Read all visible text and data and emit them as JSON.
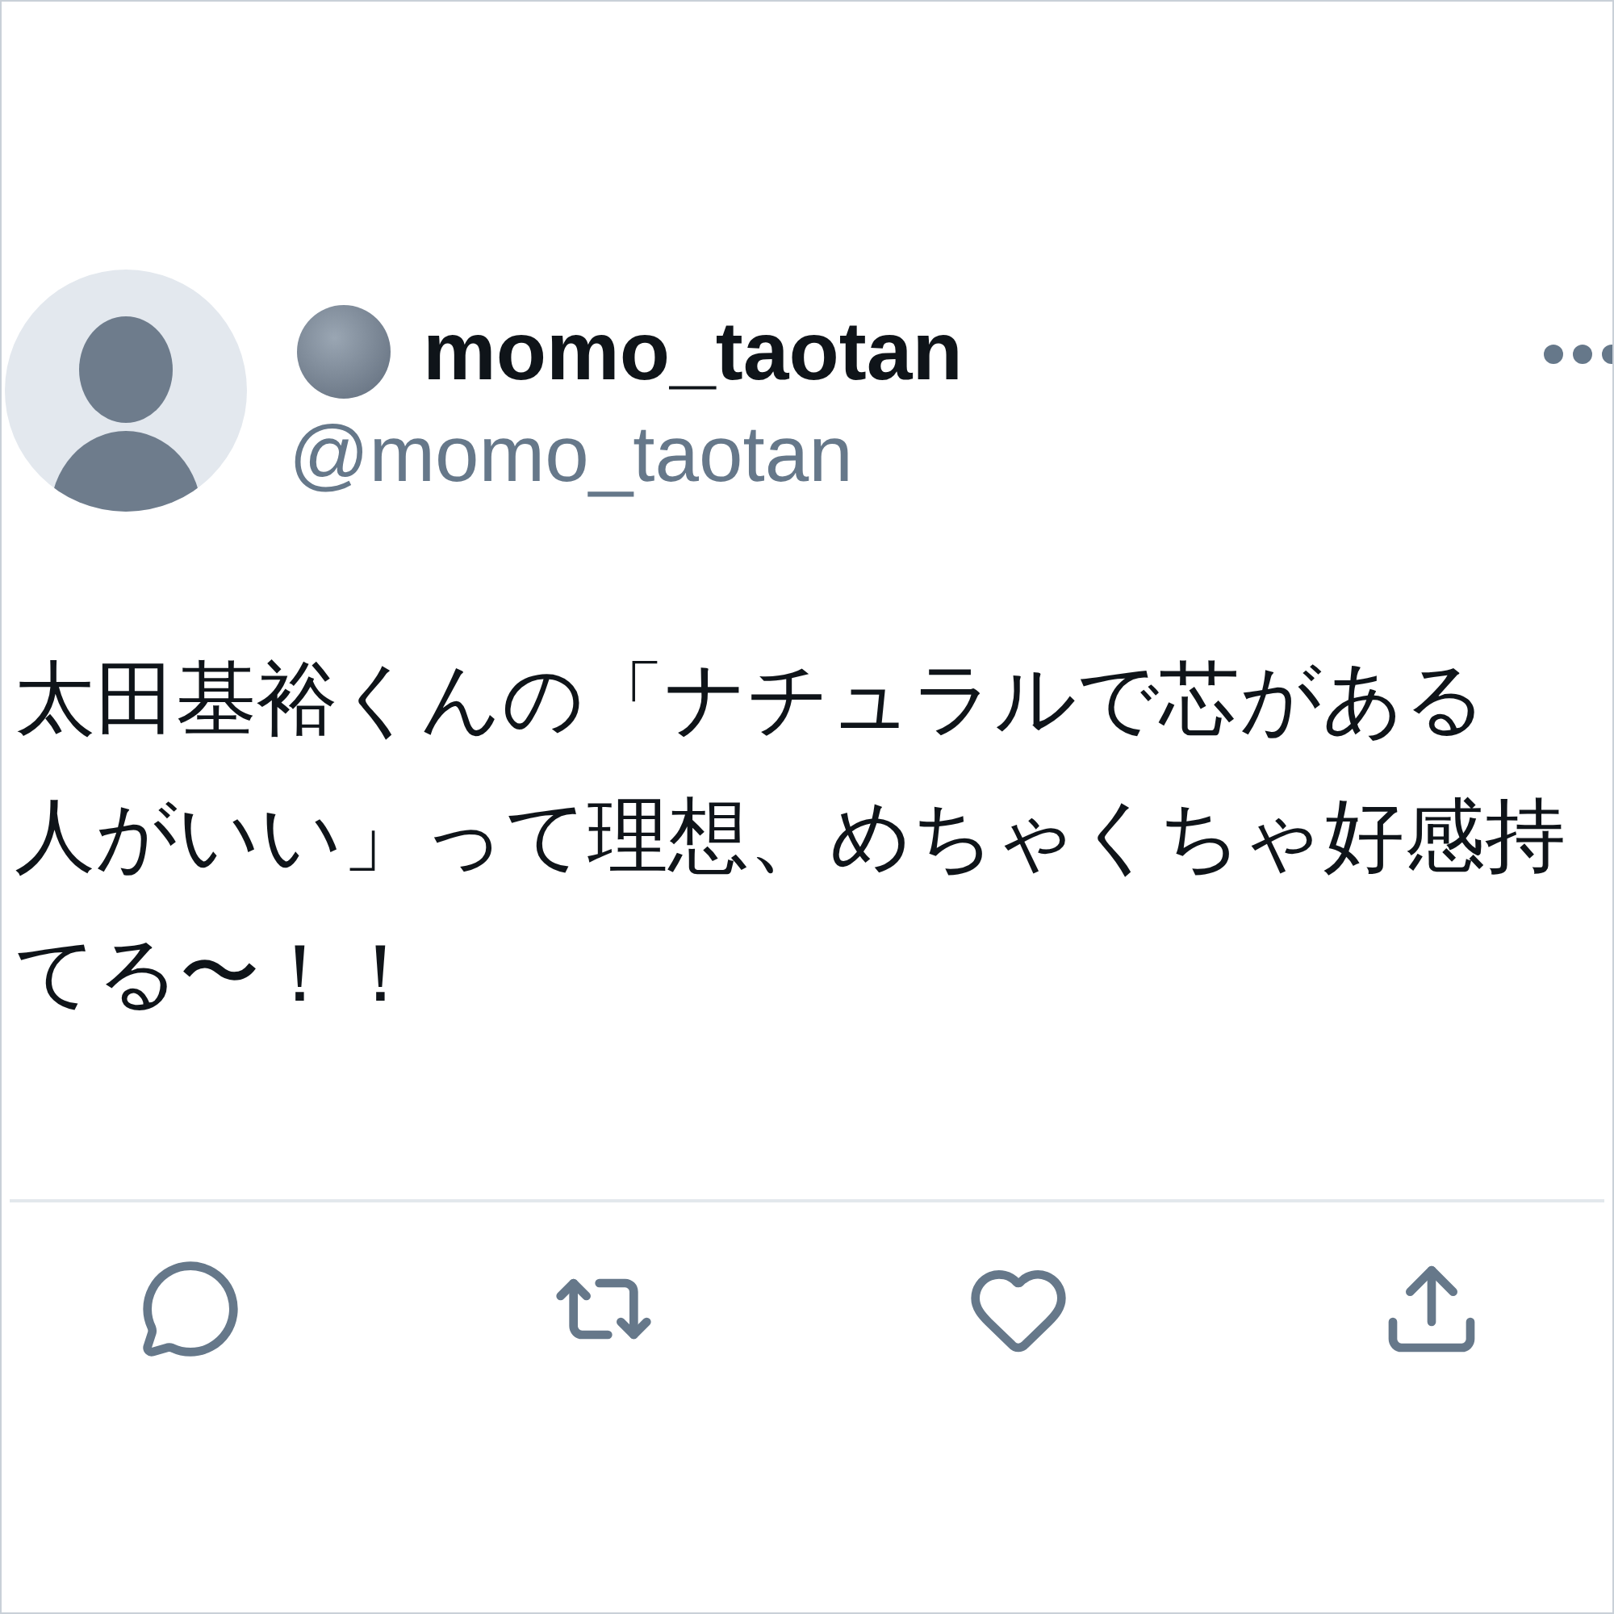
{
  "post": {
    "author": {
      "name": "momo_taotan",
      "handle": "@momo_taotan"
    },
    "text": "太田基裕くんの「ナチュラルで芯がある人がいい」って理想、めちゃくちゃ好感持てる〜！！",
    "actions": [
      {
        "kind": "reply"
      },
      {
        "kind": "repost"
      },
      {
        "kind": "like"
      },
      {
        "kind": "share"
      }
    ]
  }
}
